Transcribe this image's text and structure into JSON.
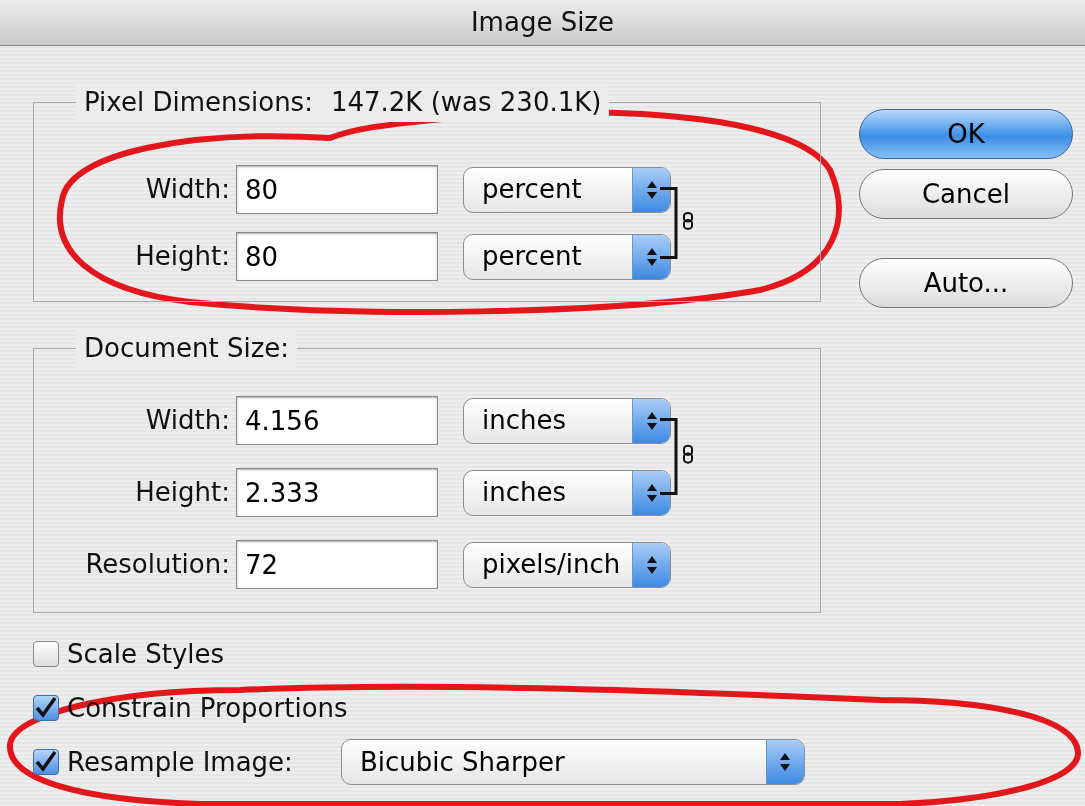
{
  "window": {
    "title": "Image Size"
  },
  "pixel_dimensions": {
    "label": "Pixel Dimensions:",
    "size": "147.2K (was 230.1K)",
    "rows": [
      {
        "label": "Width:",
        "value": "80",
        "unit": "percent",
        "linked": true
      },
      {
        "label": "Height:",
        "value": "80",
        "unit": "percent",
        "linked": true
      }
    ]
  },
  "document_size": {
    "label": "Document Size:",
    "rows": [
      {
        "label": "Width:",
        "value": "4.156",
        "unit": "inches",
        "linked": true
      },
      {
        "label": "Height:",
        "value": "2.333",
        "unit": "inches",
        "linked": true
      },
      {
        "label": "Resolution:",
        "value": "72",
        "unit": "pixels/inch",
        "linked": false
      }
    ]
  },
  "options": [
    {
      "label": "Scale Styles",
      "checked": false
    },
    {
      "label": "Constrain Proportions",
      "checked": true
    },
    {
      "label": "Resample Image:",
      "checked": true,
      "method": "Bicubic Sharper"
    }
  ],
  "buttons": [
    {
      "label": "OK",
      "default": true
    },
    {
      "label": "Cancel",
      "default": false
    },
    {
      "label": "Auto...",
      "default": false
    }
  ]
}
